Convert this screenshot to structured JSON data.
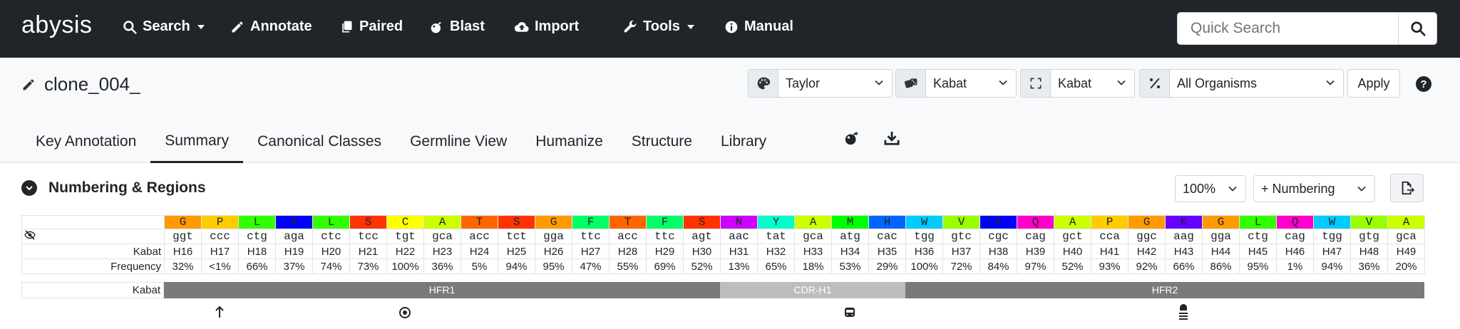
{
  "nav": {
    "logo": "abysis",
    "items": [
      {
        "label": "Search",
        "icon": "search-icon",
        "dropdown": true
      },
      {
        "label": "Annotate",
        "icon": "pencil-icon",
        "dropdown": false
      },
      {
        "label": "Paired",
        "icon": "copy-icon",
        "dropdown": false
      },
      {
        "label": "Blast",
        "icon": "bomb-icon",
        "dropdown": false
      },
      {
        "label": "Import",
        "icon": "cloud-upload-icon",
        "dropdown": false
      },
      {
        "label": "Tools",
        "icon": "wrench-icon",
        "dropdown": true
      },
      {
        "label": "Manual",
        "icon": "info-icon",
        "dropdown": false
      }
    ],
    "quick_search_placeholder": "Quick Search"
  },
  "header": {
    "title": "clone_004_",
    "selects": [
      {
        "icon": "palette-icon",
        "value": "Taylor"
      },
      {
        "icon": "dice-icon",
        "value": "Kabat"
      },
      {
        "icon": "expand-icon",
        "value": "Kabat"
      },
      {
        "icon": "percent-icon",
        "value": "All Organisms"
      }
    ],
    "apply_label": "Apply",
    "help_label": "?",
    "tabs": [
      "Key Annotation",
      "Summary",
      "Canonical Classes",
      "Germline View",
      "Humanize",
      "Structure",
      "Library"
    ],
    "active_tab": "Summary"
  },
  "section": {
    "title": "Numbering & Regions",
    "zoom_value": "100%",
    "numbering_label": "+ Numbering"
  },
  "table": {
    "row_labels": {
      "kabat": "Kabat",
      "frequency": "Frequency",
      "regions": "Kabat"
    },
    "residues": [
      {
        "aa": "G",
        "color": "#ff9b00",
        "codon": "ggt",
        "pos": "H16",
        "freq": "32%"
      },
      {
        "aa": "P",
        "color": "#ffcc00",
        "codon": "ccc",
        "pos": "H17",
        "freq": "<1%"
      },
      {
        "aa": "L",
        "color": "#33ff00",
        "codon": "ctg",
        "pos": "H18",
        "freq": "66%"
      },
      {
        "aa": "R",
        "color": "#0000ff",
        "codon": "aga",
        "pos": "H19",
        "freq": "37%"
      },
      {
        "aa": "L",
        "color": "#33ff00",
        "codon": "ctc",
        "pos": "H20",
        "freq": "74%"
      },
      {
        "aa": "S",
        "color": "#ff3300",
        "codon": "tcc",
        "pos": "H21",
        "freq": "73%"
      },
      {
        "aa": "C",
        "color": "#ffff00",
        "codon": "tgt",
        "pos": "H22",
        "freq": "100%"
      },
      {
        "aa": "A",
        "color": "#ccff00",
        "codon": "gca",
        "pos": "H23",
        "freq": "36%"
      },
      {
        "aa": "T",
        "color": "#ff6600",
        "codon": "acc",
        "pos": "H24",
        "freq": "5%"
      },
      {
        "aa": "S",
        "color": "#ff3300",
        "codon": "tct",
        "pos": "H25",
        "freq": "94%"
      },
      {
        "aa": "G",
        "color": "#ff9b00",
        "codon": "gga",
        "pos": "H26",
        "freq": "95%"
      },
      {
        "aa": "F",
        "color": "#00ff66",
        "codon": "ttc",
        "pos": "H27",
        "freq": "47%"
      },
      {
        "aa": "T",
        "color": "#ff6600",
        "codon": "acc",
        "pos": "H28",
        "freq": "55%"
      },
      {
        "aa": "F",
        "color": "#00ff66",
        "codon": "ttc",
        "pos": "H29",
        "freq": "69%"
      },
      {
        "aa": "S",
        "color": "#ff3300",
        "codon": "agt",
        "pos": "H30",
        "freq": "52%"
      },
      {
        "aa": "N",
        "color": "#cc00ff",
        "codon": "aac",
        "pos": "H31",
        "freq": "13%"
      },
      {
        "aa": "Y",
        "color": "#00ffcc",
        "codon": "tat",
        "pos": "H32",
        "freq": "65%"
      },
      {
        "aa": "A",
        "color": "#ccff00",
        "codon": "gca",
        "pos": "H33",
        "freq": "18%"
      },
      {
        "aa": "M",
        "color": "#00ff00",
        "codon": "atg",
        "pos": "H34",
        "freq": "53%"
      },
      {
        "aa": "H",
        "color": "#0066ff",
        "codon": "cac",
        "pos": "H35",
        "freq": "29%"
      },
      {
        "aa": "W",
        "color": "#00ccff",
        "codon": "tgg",
        "pos": "H36",
        "freq": "100%"
      },
      {
        "aa": "V",
        "color": "#99ff00",
        "codon": "gtc",
        "pos": "H37",
        "freq": "72%"
      },
      {
        "aa": "R",
        "color": "#0000ff",
        "codon": "cgc",
        "pos": "H38",
        "freq": "84%"
      },
      {
        "aa": "Q",
        "color": "#ff00cc",
        "codon": "cag",
        "pos": "H39",
        "freq": "97%"
      },
      {
        "aa": "A",
        "color": "#ccff00",
        "codon": "gct",
        "pos": "H40",
        "freq": "52%"
      },
      {
        "aa": "P",
        "color": "#ffcc00",
        "codon": "cca",
        "pos": "H41",
        "freq": "93%"
      },
      {
        "aa": "G",
        "color": "#ff9b00",
        "codon": "ggc",
        "pos": "H42",
        "freq": "92%"
      },
      {
        "aa": "K",
        "color": "#6600ff",
        "codon": "aag",
        "pos": "H43",
        "freq": "66%"
      },
      {
        "aa": "G",
        "color": "#ff9b00",
        "codon": "gga",
        "pos": "H44",
        "freq": "86%"
      },
      {
        "aa": "L",
        "color": "#33ff00",
        "codon": "ctg",
        "pos": "H45",
        "freq": "95%"
      },
      {
        "aa": "Q",
        "color": "#ff00cc",
        "codon": "cag",
        "pos": "H46",
        "freq": "1%"
      },
      {
        "aa": "W",
        "color": "#00ccff",
        "codon": "tgg",
        "pos": "H47",
        "freq": "94%"
      },
      {
        "aa": "V",
        "color": "#99ff00",
        "codon": "gtg",
        "pos": "H48",
        "freq": "36%"
      },
      {
        "aa": "A",
        "color": "#ccff00",
        "codon": "gca",
        "pos": "H49",
        "freq": "20%"
      }
    ],
    "regions": [
      {
        "name": "HFR1",
        "span": 15,
        "color": "#7a7a7a"
      },
      {
        "name": "CDR-H1",
        "span": 5,
        "color": "#bdbdbd"
      },
      {
        "name": "HFR2",
        "span": 14,
        "color": "#7a7a7a"
      }
    ],
    "markers": [
      {
        "index": 1,
        "icon": "arrow-up-icon"
      },
      {
        "index": 6,
        "icon": "dot-circle-icon"
      },
      {
        "index": 18,
        "icon": "bus-icon"
      },
      {
        "index": 27,
        "icon": "bell-stack-icon"
      }
    ]
  }
}
